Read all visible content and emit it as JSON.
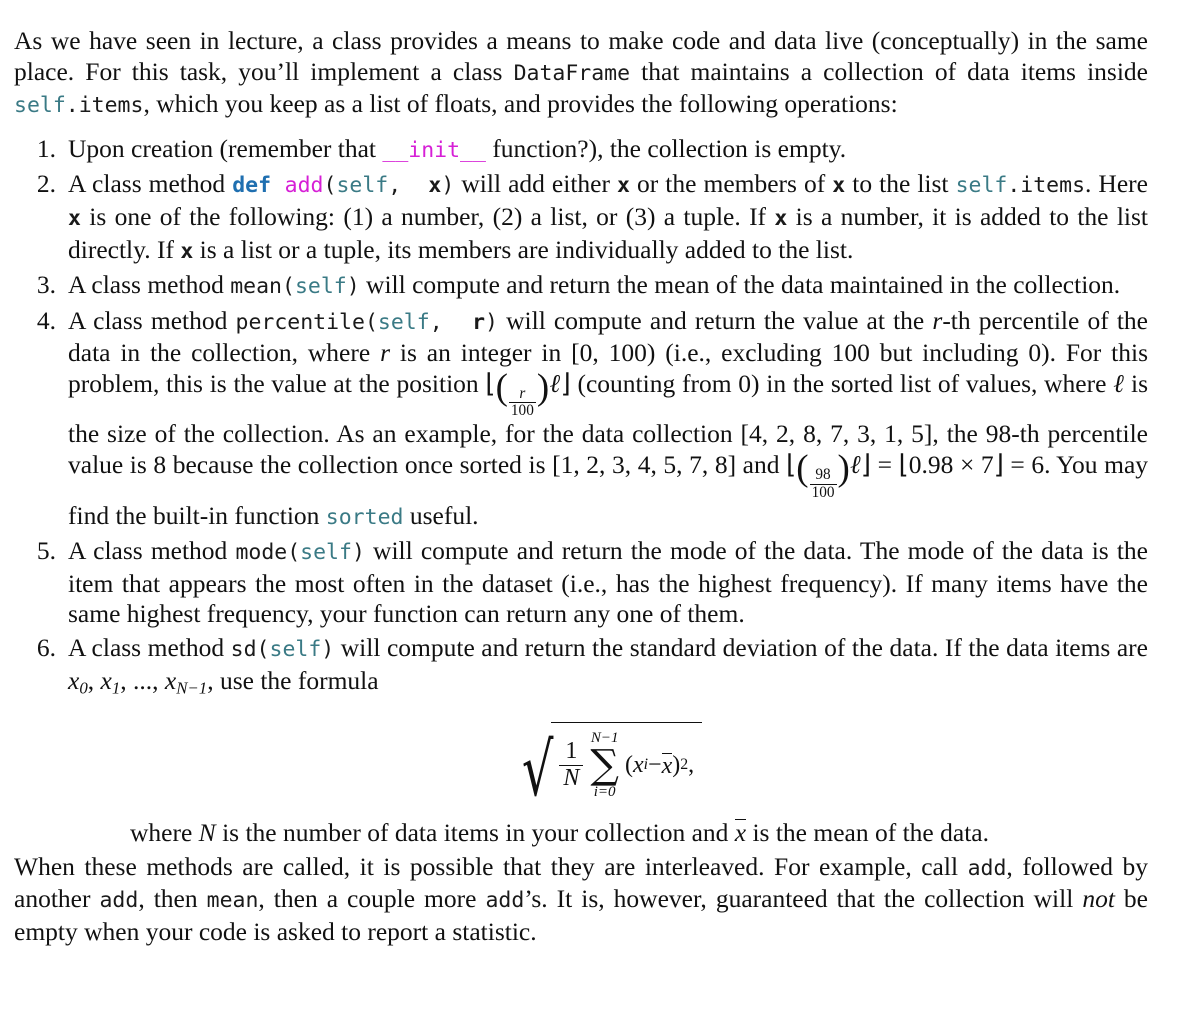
{
  "document": {
    "intro": {
      "p1_a": "As we have seen in lecture, a class provides a means to make code and data live (conceptually) in the same place. For this task, you’ll implement a class ",
      "p1_code_dataframe": "DataFrame",
      "p1_b": " that maintains a collection of data items inside ",
      "p1_code_selfitems_self": "self",
      "p1_code_selfitems_rest": ".items",
      "p1_c": ", which you keep as a list of floats, and provides the following operations:"
    },
    "items": [
      {
        "number": "1.",
        "a": "Upon creation (remember that ",
        "code_init": "__init__",
        "b": " function?), the collection is empty."
      },
      {
        "number": "2.",
        "a": "A class method ",
        "code_def": "def",
        "code_space": " ",
        "code_add": "add",
        "code_open": "(",
        "code_self": "self",
        "code_comma": ",  ",
        "code_x": "x",
        "code_close": ")",
        "b": " will add either ",
        "code_x2": "x",
        "c": " or the members of ",
        "code_x3": "x",
        "d": " to the list ",
        "code_self2": "self",
        "code_items2": ".items",
        "e": ". Here ",
        "code_x4": "x",
        "f": " is one of the following: (1) a number, (2) a list, or (3) a tuple. If ",
        "code_x5": "x",
        "g": " is a number, it is added to the list directly. If ",
        "code_x6": "x",
        "h": " is a list or a tuple, its members are individually added to the list."
      },
      {
        "number": "3.",
        "a": "A class method ",
        "code_mean": "mean",
        "code_open": "(",
        "code_self": "self",
        "code_close": ")",
        "b": " will compute and return the mean of the data maintained in the collection."
      },
      {
        "number": "4.",
        "a": "A class method ",
        "code_percentile": "percentile",
        "code_open": "(",
        "code_self": "self",
        "code_comma": ",  ",
        "code_r": "r",
        "code_close": ")",
        "b": " will compute and return the value at the ",
        "var_r": "r",
        "c": "-th percentile of the data in the collection, where ",
        "var_r2": "r",
        "d": " is an integer in [0, 100) (i.e., excluding 100 but including 0). For this problem, this is the value at the position ",
        "floor_open": "⌊",
        "paren_open": "(",
        "frac1_num": "r",
        "frac1_den": "100",
        "paren_close": ")",
        "ell": "ℓ",
        "floor_close": "⌋",
        "e": " (counting from 0) in the sorted list of values, where ",
        "ell2": "ℓ",
        "f": " is the size of the collection. As an example, for the data collection [4, 2, 8, 7, 3, 1, 5], the 98-th percentile value is 8 because the collection once sorted is [1, 2, 3, 4, 5, 7, 8] and ",
        "floor_open2": "⌊",
        "paren_open2": "(",
        "frac2_num": "98",
        "frac2_den": "100",
        "paren_close2": ")",
        "ell3": "ℓ",
        "floor_close2": "⌋",
        "g": " = ",
        "floor_open3": "⌊",
        "h": "0.98 × 7",
        "floor_close3": "⌋",
        "i": " = 6. You may find the built-in function ",
        "code_sorted": "sorted",
        "j": " useful."
      },
      {
        "number": "5.",
        "a": "A class method ",
        "code_mode": "mode",
        "code_open": "(",
        "code_self": "self",
        "code_close": ")",
        "b": " will compute and return the mode of the data.  The mode of the data is the item that appears the most often in the dataset (i.e., has the highest frequency).  If many items have the same highest frequency, your function can return any one of them."
      },
      {
        "number": "6.",
        "a": "A class method ",
        "code_sd": "sd",
        "code_open": "(",
        "code_self": "self",
        "code_close": ")",
        "b": " will compute and return the standard deviation of the data. If the data items are ",
        "var_x0": "x",
        "sub_0": "0",
        "sep1": ", ",
        "var_x1": "x",
        "sub_1": "1",
        "sep2": ", ..., ",
        "var_xN": "x",
        "sub_N": "N−1",
        "c": ", use the formula"
      }
    ],
    "formula": {
      "radical": "√",
      "frac_num": "1",
      "frac_den": "N",
      "sum_top": "N−1",
      "sigma": "∑",
      "sum_bot": "i=0",
      "open_paren": "(",
      "x_var": "x",
      "x_sub": "i",
      "minus": " − ",
      "xbar": "x",
      "close_paren": ")",
      "power": "2",
      "trailing_comma": ","
    },
    "where_line": {
      "a": "where ",
      "var_N": "N",
      "b": " is the number of data items in your collection and ",
      "xbar": "x",
      "c": " is the mean of the data."
    },
    "closing": {
      "a": "When these methods are called, it is possible that they are interleaved. For example, call ",
      "code_add": "add",
      "b": ", followed by another ",
      "code_add2": "add",
      "c": ", then ",
      "code_mean": "mean",
      "d": ", then a couple more ",
      "code_add3": "add",
      "e": "’s. It is, however, guaranteed that the collection will ",
      "italic_not": "not",
      "f": " be empty when your code is asked to report a statistic."
    }
  },
  "colors": {
    "text": "#111111",
    "code_default": "#1a1a1a",
    "code_keyword": "#1f6fb0",
    "code_function": "#d61fd6",
    "code_self": "#3a7a85",
    "background": "#ffffff"
  }
}
